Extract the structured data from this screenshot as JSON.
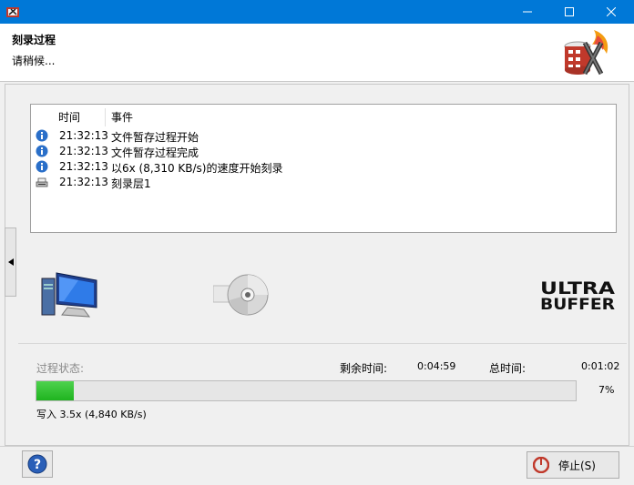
{
  "header": {
    "title": "刻录过程",
    "subtitle": "请稍候..."
  },
  "log": {
    "columns": [
      "时间",
      "事件"
    ],
    "rows": [
      {
        "icon": "info-icon",
        "time": "21:32:13",
        "event": "文件暂存过程开始"
      },
      {
        "icon": "info-icon",
        "time": "21:32:13",
        "event": "文件暂存过程完成"
      },
      {
        "icon": "info-icon",
        "time": "21:32:13",
        "event": "以6x (8,310 KB/s)的速度开始刻录"
      },
      {
        "icon": "burner-icon",
        "time": "21:32:13",
        "event": "刻录层1"
      }
    ]
  },
  "status": {
    "label": "过程状态:",
    "remaining_label": "剩余时间:",
    "remaining_value": "0:04:59",
    "total_label": "总时间:",
    "total_value": "0:01:02",
    "progress_percent": 7,
    "progress_text": "7%",
    "write_speed": "写入 3.5x (4,840 KB/s)"
  },
  "footer": {
    "stop_label": "停止(S)"
  },
  "colors": {
    "titlebar": "#0078d7",
    "progress": "#26b826"
  }
}
